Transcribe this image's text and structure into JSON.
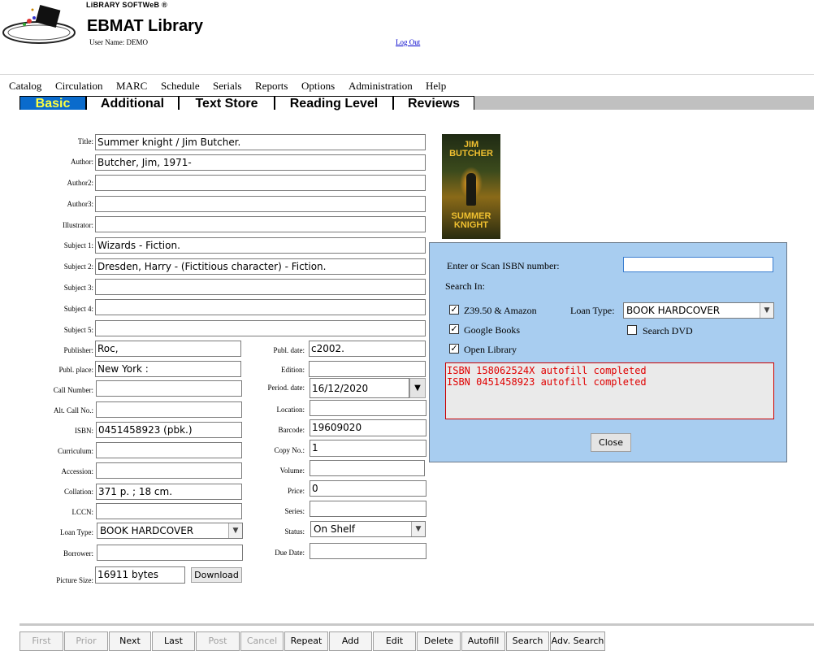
{
  "header": {
    "brand": "LiBRARY SOFTWeB ®",
    "title": "EBMAT Library",
    "user_name": "User Name: DEMO",
    "logout": "Log Out"
  },
  "menu": [
    "Catalog",
    "Circulation",
    "MARC",
    "Schedule",
    "Serials",
    "Reports",
    "Options",
    "Administration",
    "Help"
  ],
  "tabs": [
    "Basic",
    "Additional",
    "Text Store",
    "Reading Level",
    "Reviews"
  ],
  "active_tab": "Basic",
  "form": {
    "title_label": "Title:",
    "title": "Summer knight /   Jim Butcher.",
    "author_label": "Author:",
    "author": "Butcher, Jim,   1971-",
    "author2_label": "Author2:",
    "author2": "",
    "author3_label": "Author3:",
    "author3": "",
    "illustrator_label": "Illustrator:",
    "illustrator": "",
    "subject1_label": "Subject 1:",
    "subject1": "Wizards  -  Fiction.",
    "subject2_label": "Subject 2:",
    "subject2": "Dresden, Harry  -  (Fictitious character)  -  Fiction.",
    "subject3_label": "Subject 3:",
    "subject3": "",
    "subject4_label": "Subject 4:",
    "subject4": "",
    "subject5_label": "Subject 5:",
    "subject5": "",
    "publisher_label": "Publisher:",
    "publisher": "Roc,",
    "publ_place_label": "Publ. place:",
    "publ_place": "New York :",
    "call_number_label": "Call Number:",
    "call_number": "",
    "alt_call_label": "Alt. Call No.:",
    "alt_call": "",
    "isbn_label": "ISBN:",
    "isbn": "0451458923 (pbk.)",
    "curriculum_label": "Curriculum:",
    "curriculum": "",
    "accession_label": "Accession:",
    "accession": "",
    "collation_label": "Collation:",
    "collation": "371 p. ;   18 cm.",
    "lccn_label": "LCCN:",
    "lccn": "",
    "loan_type_label": "Loan Type:",
    "loan_type": "BOOK HARDCOVER",
    "borrower_label": "Borrower:",
    "borrower": "",
    "picture_size_label": "Picture Size:",
    "picture_size": "16911 bytes",
    "download_label": "Download",
    "publ_date_label": "Publ. date:",
    "publ_date": "c2002.",
    "edition_label": "Edition:",
    "edition": "",
    "period_date_label": "Period. date:",
    "period_date": "16/12/2020",
    "location_label": "Location:",
    "location": "",
    "barcode_label": "Barcode:",
    "barcode": "19609020",
    "copy_no_label": "Copy No.:",
    "copy_no": "1",
    "volume_label": "Volume:",
    "volume": "",
    "price_label": "Price:",
    "price": "0",
    "series_label": "Series:",
    "series": "",
    "status_label": "Status:",
    "status": "On Shelf",
    "due_date_label": "Due Date:",
    "due_date": ""
  },
  "cover": {
    "top_text": "JIM BUTCHER",
    "bottom_text": "SUMMER KNIGHT"
  },
  "isbn_popup": {
    "prompt": "Enter or Scan ISBN number:",
    "isbn_value": "",
    "search_in": "Search In:",
    "z3950": "Z39.50 & Amazon",
    "z3950_checked": true,
    "google": "Google Books",
    "google_checked": true,
    "open_library": "Open Library",
    "open_library_checked": true,
    "loan_type_label": "Loan Type:",
    "loan_type": "BOOK HARDCOVER",
    "search_dvd": "Search DVD",
    "search_dvd_checked": false,
    "log": [
      "ISBN 158062524X autofill completed",
      "ISBN 0451458923 autofill completed"
    ],
    "close": "Close"
  },
  "nav_buttons": [
    {
      "label": "First",
      "enabled": false
    },
    {
      "label": "Prior",
      "enabled": false
    },
    {
      "label": "Next",
      "enabled": true
    },
    {
      "label": "Last",
      "enabled": true
    },
    {
      "label": "Post",
      "enabled": false
    },
    {
      "label": "Cancel",
      "enabled": false
    },
    {
      "label": "Repeat",
      "enabled": true
    },
    {
      "label": "Add",
      "enabled": true
    },
    {
      "label": "Edit",
      "enabled": true
    },
    {
      "label": "Delete",
      "enabled": true
    },
    {
      "label": "Autofill",
      "enabled": true
    },
    {
      "label": "Search",
      "enabled": true
    },
    {
      "label": "Adv. Search",
      "enabled": true
    }
  ],
  "colors": {
    "active_tab_bg": "#0a6bcc",
    "active_tab_text": "#ffff40",
    "popup_bg": "#a8cdf0",
    "log_text": "#e00000"
  }
}
